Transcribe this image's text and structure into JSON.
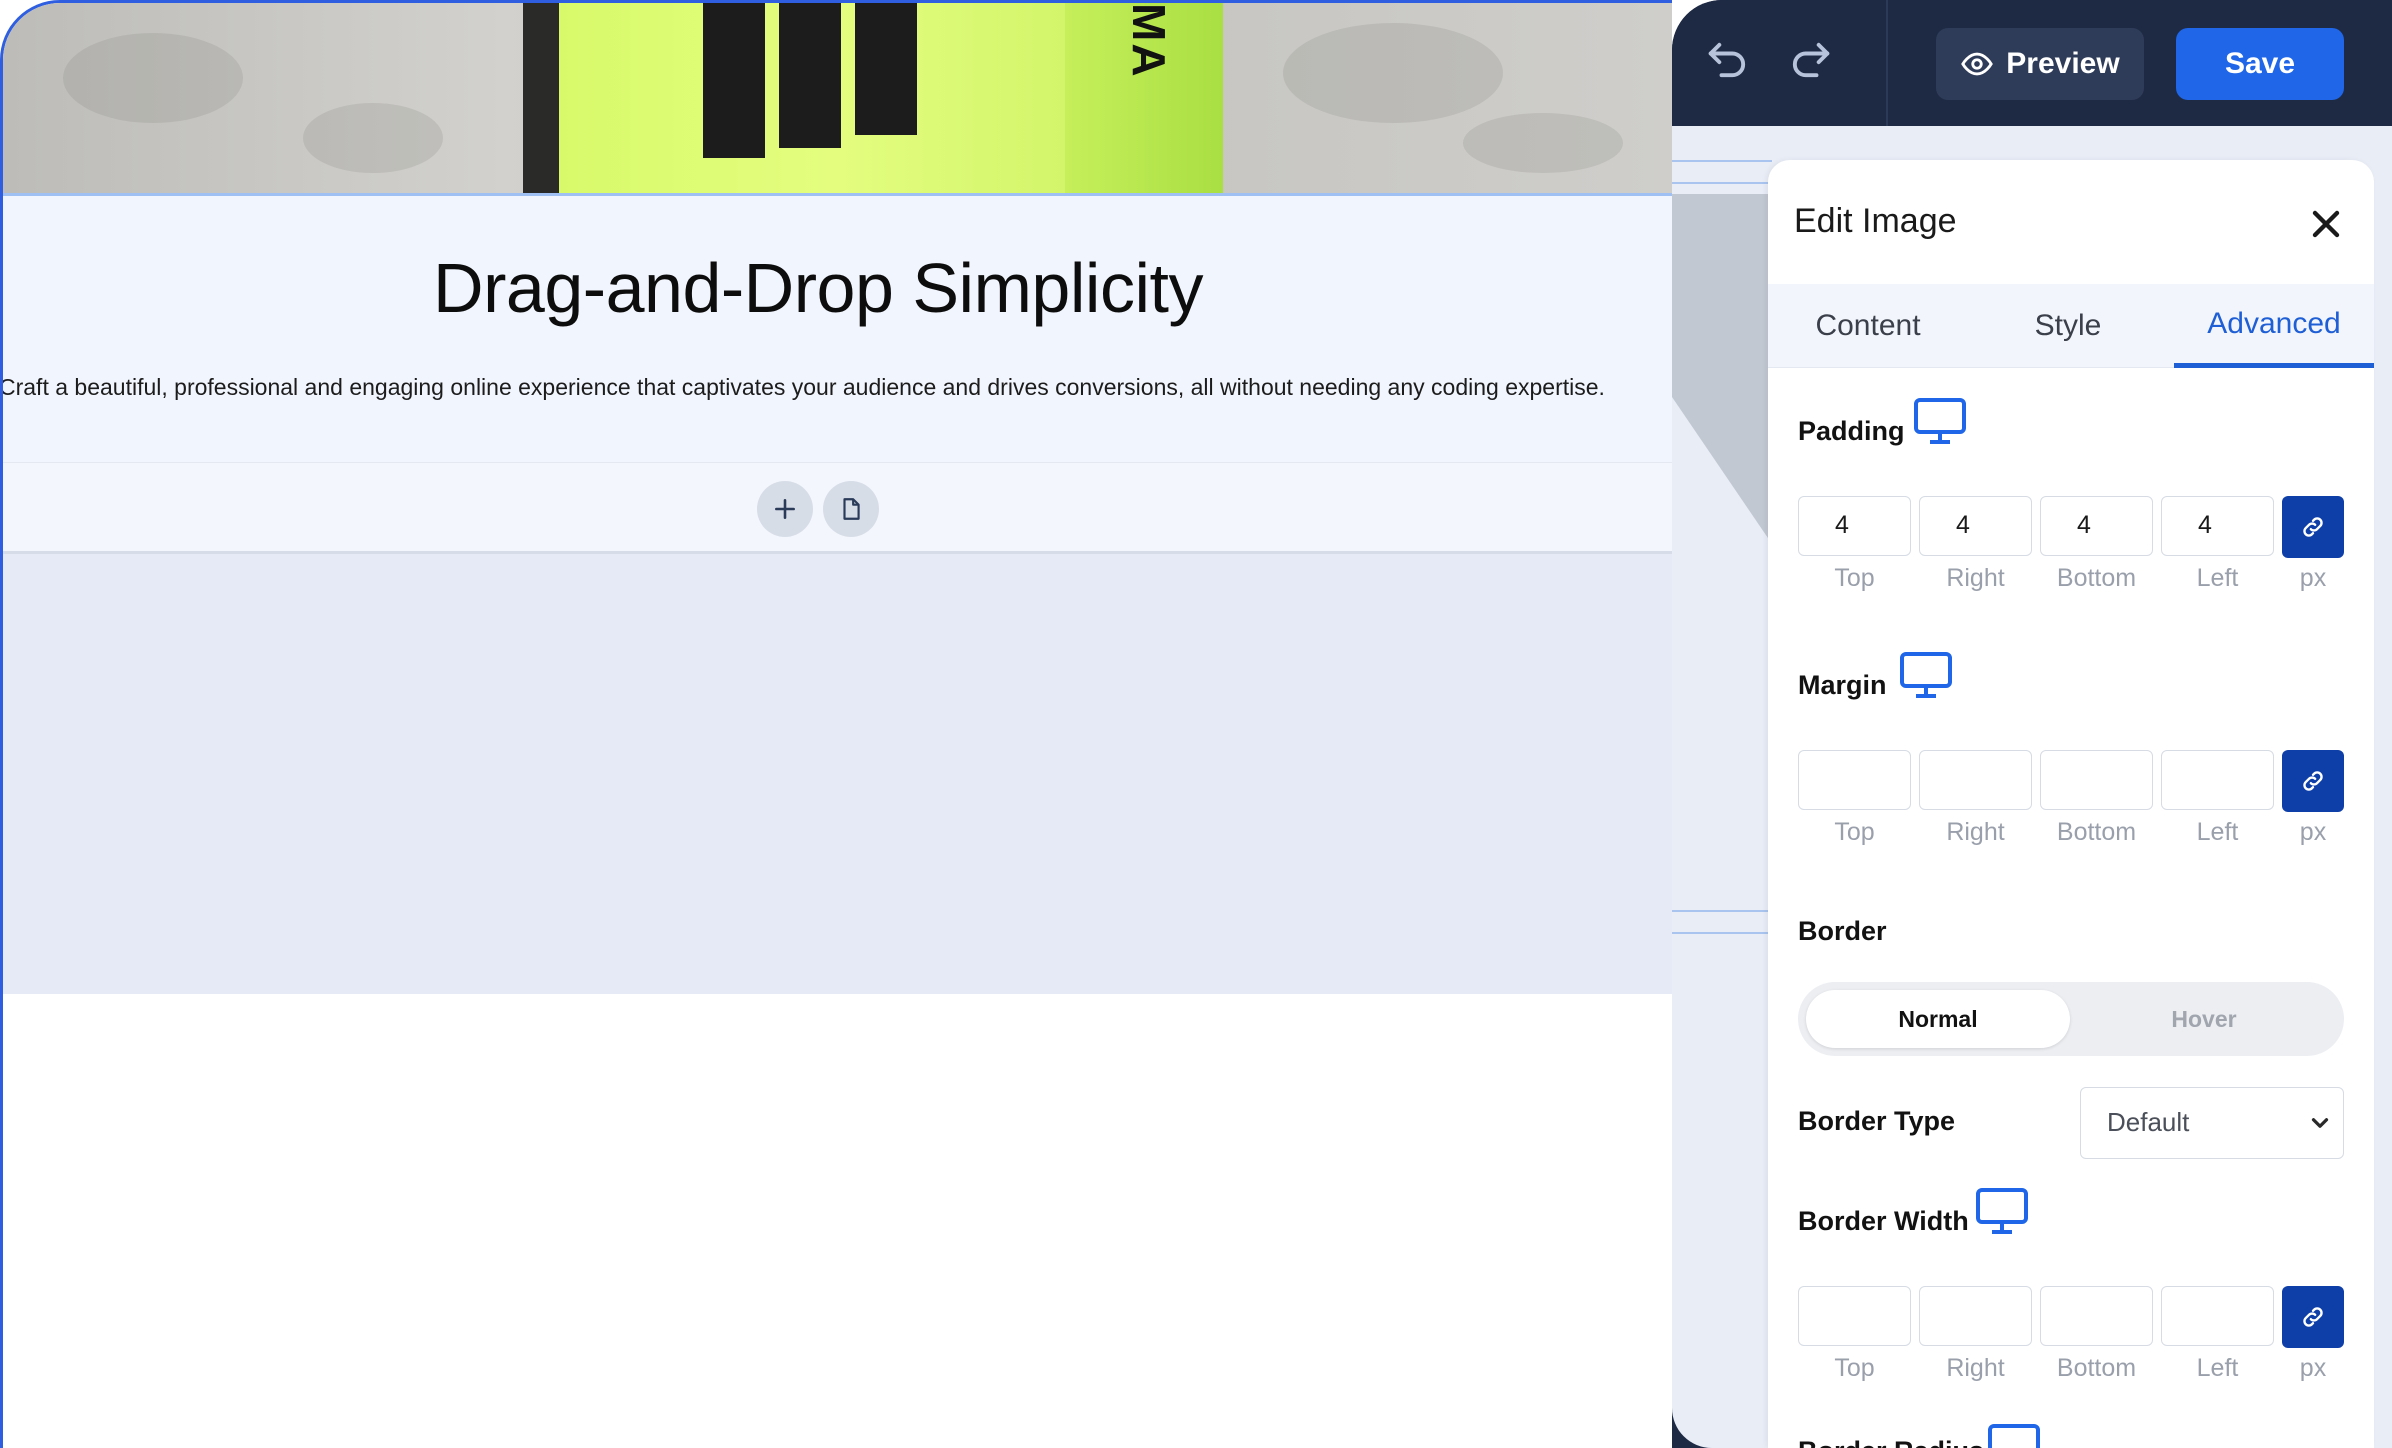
{
  "canvas": {
    "box_text": "MA",
    "heading": "Drag-and-Drop Simplicity",
    "subtext": "Craft a beautiful, professional and engaging online experience that captivates your audience and drives conversions, all without needing any coding expertise."
  },
  "topbar": {
    "preview_label": "Preview",
    "save_label": "Save"
  },
  "panel": {
    "title": "Edit Image",
    "tabs": [
      {
        "label": "Content"
      },
      {
        "label": "Style"
      },
      {
        "label": "Advanced"
      }
    ],
    "active_tab": "Advanced",
    "padding": {
      "label": "Padding",
      "top": "4",
      "right": "4",
      "bottom": "4",
      "left": "4",
      "labels": [
        "Top",
        "Right",
        "Bottom",
        "Left"
      ],
      "unit": "px"
    },
    "margin": {
      "label": "Margin",
      "top": "",
      "right": "",
      "bottom": "",
      "left": "",
      "labels": [
        "Top",
        "Right",
        "Bottom",
        "Left"
      ],
      "unit": "px"
    },
    "border": {
      "label": "Border",
      "states": [
        "Normal",
        "Hover"
      ],
      "active_state": "Normal"
    },
    "border_type": {
      "label": "Border Type",
      "value": "Default"
    },
    "border_width": {
      "label": "Border Width",
      "top": "",
      "right": "",
      "bottom": "",
      "left": "",
      "labels": [
        "Top",
        "Right",
        "Bottom",
        "Left"
      ],
      "unit": "px"
    },
    "border_radius": {
      "label": "Border Radius"
    }
  },
  "colors": {
    "accent": "#1f66e8",
    "link_button": "#0e3fa8",
    "topbar_bg": "#1e2a44",
    "active_tab": "#1f5fd6"
  }
}
